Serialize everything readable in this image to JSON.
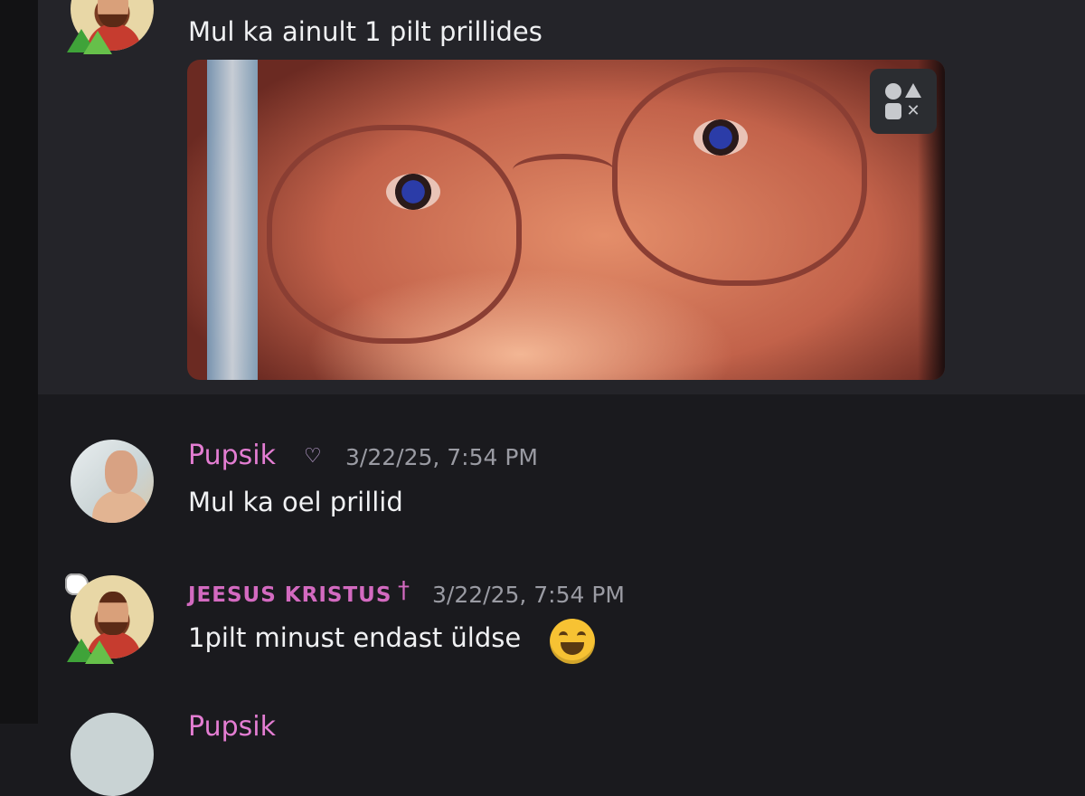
{
  "messages": [
    {
      "author": "JEESUS KRISTUS",
      "text": "Mul ka ainult 1 pilt prillides",
      "attachment": {
        "type": "image",
        "description_icon": "media-menu-icon"
      }
    },
    {
      "author": "Pupsik",
      "badge_icon": "heart-outline-icon",
      "timestamp": "3/22/25, 7:54 PM",
      "text": "Mul ka oel prillid"
    },
    {
      "author": "JEESUS KRISTUS",
      "badge_icon": "cross-icon",
      "badge_char": "†",
      "timestamp": "3/22/25, 7:54 PM",
      "text": "1pilt minust endast üldse",
      "emoji": "grinning-face-with-smiling-eyes"
    },
    {
      "author": "Pupsik"
    }
  ],
  "colors": {
    "background": "#1a1a1e",
    "hover_background": "#242429",
    "username_pink": "#e37dd2",
    "timestamp_gray": "#9a9ba3",
    "text": "#f0f1f3"
  }
}
